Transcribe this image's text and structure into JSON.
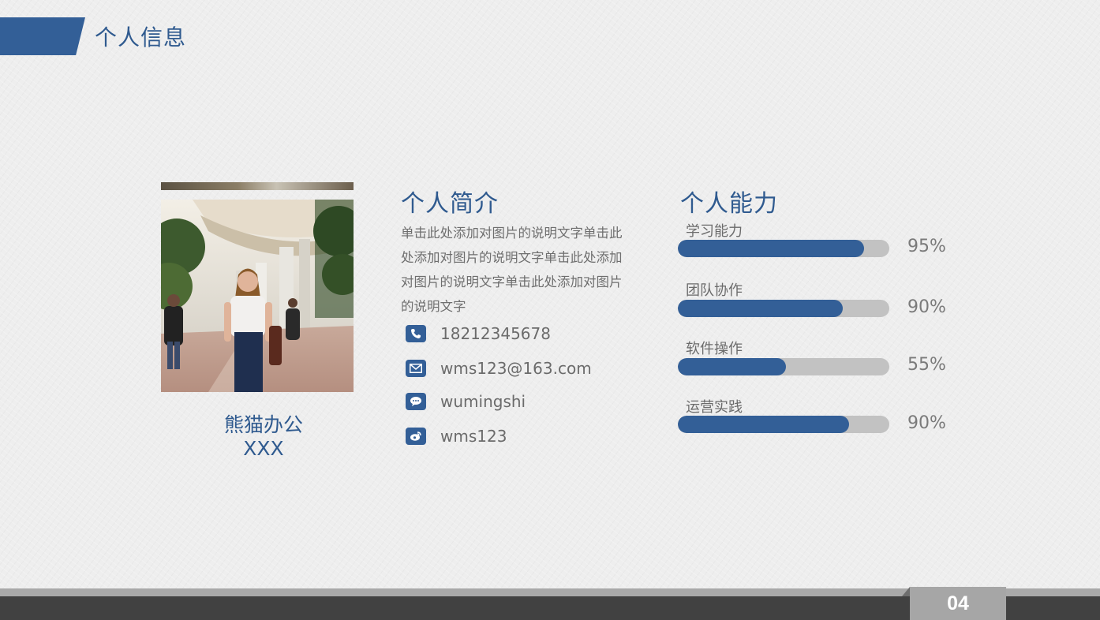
{
  "header": {
    "title": "个人信息"
  },
  "profile": {
    "name_line1": "熊猫办公",
    "name_line2": "XXX"
  },
  "intro": {
    "heading": "个人简介",
    "text": "单击此处添加对图片的说明文字单击此处添加对图片的说明文字单击此处添加对图片的说明文字单击此处添加对图片的说明文字"
  },
  "contacts": [
    {
      "icon": "phone-icon",
      "value": "18212345678"
    },
    {
      "icon": "mail-icon",
      "value": "wms123@163.com"
    },
    {
      "icon": "chat-icon",
      "value": "wumingshi"
    },
    {
      "icon": "weibo-icon",
      "value": "wms123"
    }
  ],
  "skills": {
    "heading": "个人能力",
    "items": [
      {
        "label": "学习能力",
        "percent_text": "95%",
        "fill_fraction": 0.88
      },
      {
        "label": "团队协作",
        "percent_text": "90%",
        "fill_fraction": 0.78
      },
      {
        "label": "软件操作",
        "percent_text": "55%",
        "fill_fraction": 0.51
      },
      {
        "label": "运营实践",
        "percent_text": "90%",
        "fill_fraction": 0.81
      }
    ]
  },
  "footer": {
    "page_number": "04"
  },
  "colors": {
    "accent": "#335f97",
    "track": "#c2c2c2",
    "footer_dark": "#414141",
    "footer_tab": "#a6a6a6"
  }
}
